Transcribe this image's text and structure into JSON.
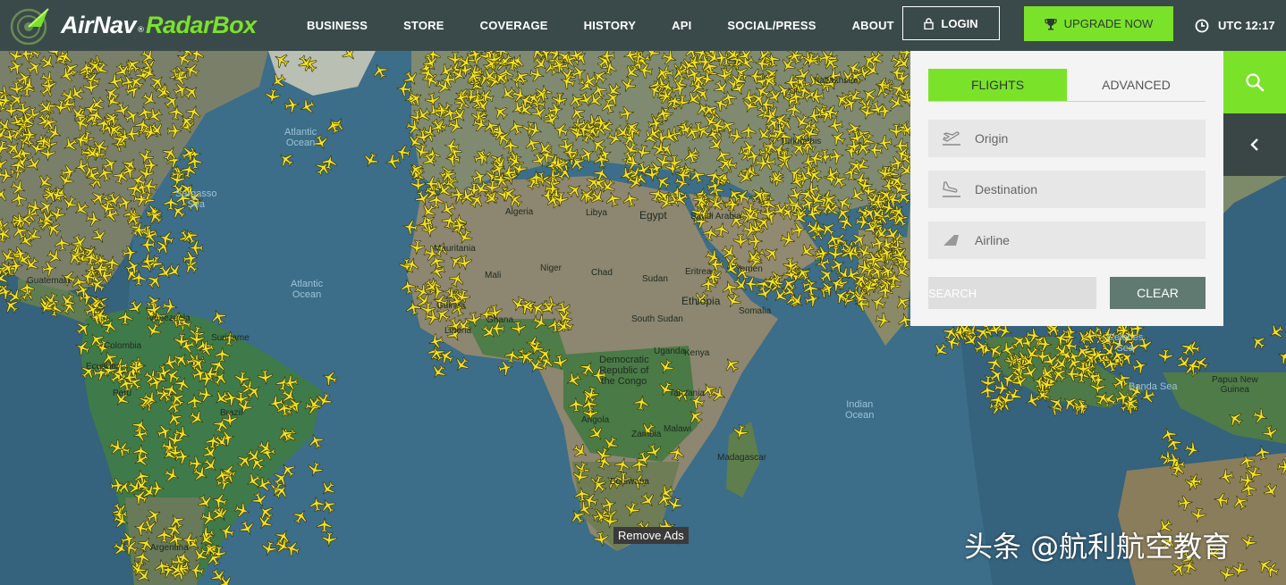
{
  "brand": {
    "name_part1": "AirNav",
    "reg": "®",
    "name_part2": "RadarBox"
  },
  "nav": {
    "items": [
      {
        "label": "BUSINESS"
      },
      {
        "label": "STORE"
      },
      {
        "label": "COVERAGE"
      },
      {
        "label": "HISTORY"
      },
      {
        "label": "API"
      },
      {
        "label": "SOCIAL/PRESS"
      },
      {
        "label": "ABOUT"
      }
    ],
    "login_label": "LOGIN",
    "upgrade_label": "UPGRADE NOW",
    "utc_label": "UTC 12:17"
  },
  "colors": {
    "accent": "#7be22a",
    "topbar": "#3a4a4a",
    "plane": "#f5e31f",
    "clear_button": "#607a72"
  },
  "search_panel": {
    "tabs": [
      {
        "label": "FLIGHTS",
        "active": true
      },
      {
        "label": "ADVANCED",
        "active": false
      }
    ],
    "origin_placeholder": "Origin",
    "destination_placeholder": "Destination",
    "airline_placeholder": "Airline",
    "search_label": "SEARCH",
    "clear_label": "CLEAR"
  },
  "icons": {
    "search_tab": "magnifier-icon",
    "collapse_tab": "chevron-left-icon",
    "login": "lock-icon",
    "upgrade": "trophy-icon",
    "utc": "clock-icon",
    "origin": "takeoff-icon",
    "destination": "landing-icon",
    "airline": "airline-tail-icon"
  },
  "map": {
    "labels": [
      {
        "text": "Sargasso\nSea",
        "kind": "ocean"
      },
      {
        "text": "Atlantic\nOcean",
        "kind": "ocean"
      },
      {
        "text": "Atlantic\nOcean",
        "kind": "ocean"
      },
      {
        "text": "Indian\nOcean",
        "kind": "ocean"
      },
      {
        "text": "Algeria",
        "kind": "country"
      },
      {
        "text": "Libya",
        "kind": "country"
      },
      {
        "text": "Egypt",
        "kind": "country"
      },
      {
        "text": "Mauritania",
        "kind": "country"
      },
      {
        "text": "Mali",
        "kind": "country"
      },
      {
        "text": "Niger",
        "kind": "country"
      },
      {
        "text": "Chad",
        "kind": "country"
      },
      {
        "text": "Sudan",
        "kind": "country"
      },
      {
        "text": "Eritrea",
        "kind": "country"
      },
      {
        "text": "Yemen",
        "kind": "country"
      },
      {
        "text": "Ethiopia",
        "kind": "country"
      },
      {
        "text": "Somalia",
        "kind": "country"
      },
      {
        "text": "South Sudan",
        "kind": "country"
      },
      {
        "text": "Democratic\nRepublic of\nthe Congo",
        "kind": "country"
      },
      {
        "text": "Tanzania",
        "kind": "country"
      },
      {
        "text": "Angola",
        "kind": "country"
      },
      {
        "text": "Zambia",
        "kind": "country"
      },
      {
        "text": "Malawi",
        "kind": "country"
      },
      {
        "text": "Madagascar",
        "kind": "country"
      },
      {
        "text": "Botswana",
        "kind": "country"
      },
      {
        "text": "Kazakhstan",
        "kind": "country"
      },
      {
        "text": "Turkmenis",
        "kind": "country"
      },
      {
        "text": "Venezuela",
        "kind": "country"
      },
      {
        "text": "Colombia",
        "kind": "country"
      },
      {
        "text": "Ecuador",
        "kind": "country"
      },
      {
        "text": "Peru",
        "kind": "country"
      },
      {
        "text": "Brazil",
        "kind": "country"
      },
      {
        "text": "Suriname",
        "kind": "country"
      },
      {
        "text": "Guatemala",
        "kind": "country"
      },
      {
        "text": "Liberia",
        "kind": "country"
      },
      {
        "text": "Ghana",
        "kind": "country"
      },
      {
        "text": "Guinea",
        "kind": "country"
      },
      {
        "text": "Kenya",
        "kind": "country"
      },
      {
        "text": "Uganda",
        "kind": "country"
      },
      {
        "text": "Saudi Arabia",
        "kind": "country"
      },
      {
        "text": "Argentina",
        "kind": "country"
      },
      {
        "text": "Papua New\nGuinea",
        "kind": "country"
      },
      {
        "text": "Celebes\nSea",
        "kind": "ocean"
      },
      {
        "text": "Banda Sea",
        "kind": "ocean"
      }
    ],
    "remove_ads_label": "Remove Ads"
  },
  "watermark": "头条 @航利航空教育"
}
